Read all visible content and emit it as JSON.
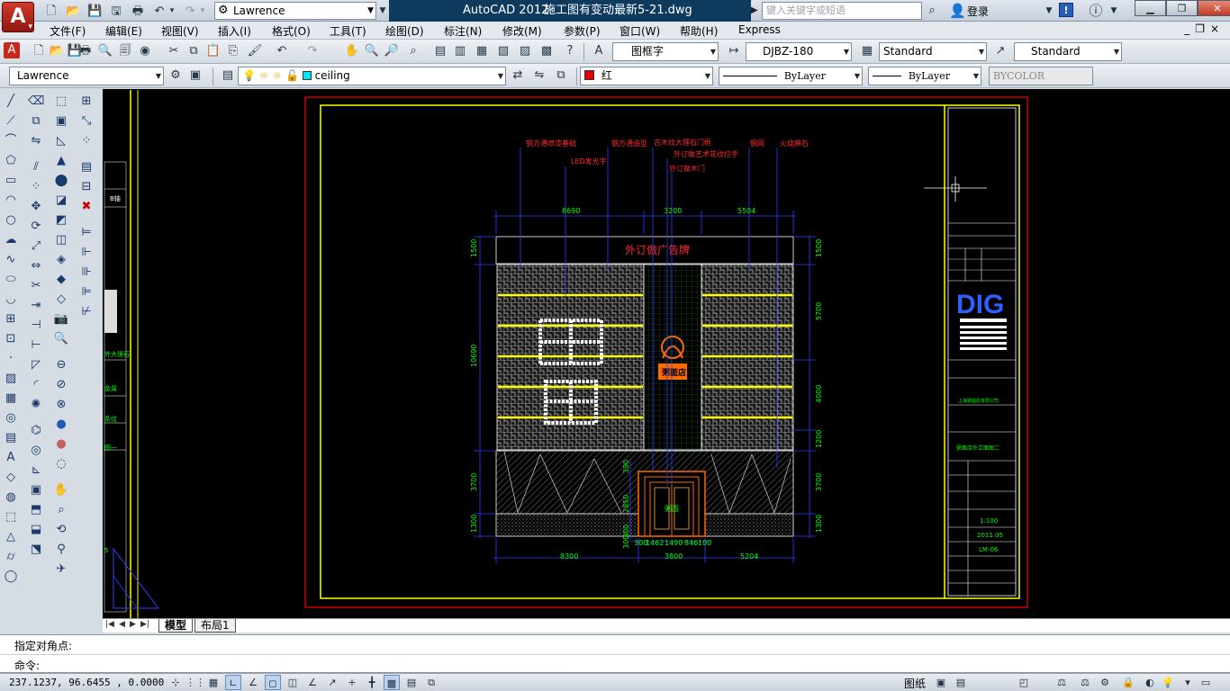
{
  "app": {
    "logo_letter": "A",
    "workspace": "Lawrence",
    "product": "AutoCAD 2012",
    "filename": "施工图有变动最新5-21.dwg",
    "search_placeholder": "键入关键字或短语",
    "login": "登录"
  },
  "menu": [
    "文件(F)",
    "编辑(E)",
    "视图(V)",
    "插入(I)",
    "格式(O)",
    "工具(T)",
    "绘图(D)",
    "标注(N)",
    "修改(M)",
    "参数(P)",
    "窗口(W)",
    "帮助(H)",
    "Express"
  ],
  "toolbar1": {
    "text_style": "图框字",
    "dim_style": "DJBZ-180",
    "table_style": "Standard",
    "multileader_style": "Standard"
  },
  "toolbar2": {
    "workspace": "Lawrence",
    "layer": "ceiling",
    "color": "红",
    "linetype": "ByLayer",
    "lineweight": "ByLayer",
    "plotstyle": "BYCOLOR"
  },
  "drawing": {
    "title": "外订做广告牌",
    "labels": [
      "钢方通喷漆基础",
      "LED发光字",
      "钢方通造型",
      "古木纹大理石门框",
      "外订做艺术花纹拉手",
      "外订做木门",
      "钢网",
      "火烧麻石"
    ],
    "dims_top": [
      "8690",
      "3200",
      "5504"
    ],
    "dims_bottom": [
      "8300",
      "3800",
      "5204"
    ],
    "dims_bottom_detail": [
      "300",
      "1462",
      "1490",
      "846",
      "100"
    ],
    "dims_left": [
      "1500",
      "10690",
      "3700",
      "1300"
    ],
    "dims_right": [
      "1500",
      "5700",
      "4000",
      "1200",
      "3700",
      "1300"
    ],
    "dims_center": [
      "390",
      "2850",
      "300",
      "300"
    ],
    "brand_text": "DIG",
    "sign_text": "粥面店",
    "door_text": "粥面",
    "titleblock": {
      "scale": "1:100",
      "date": "2011.05",
      "sheet": "LM-06",
      "project": "粥面店外立面图二",
      "owner": "上海粥面店有限公司"
    },
    "left_strip": [
      "B轴",
      "外大理石",
      "金属",
      "条纹",
      "图一",
      "5"
    ]
  },
  "tabs": [
    "模型",
    "布局1"
  ],
  "command": {
    "history": "指定对角点:",
    "prompt": "命令:"
  },
  "status": {
    "coords": "237.1237, 96.6455 , 0.0000",
    "paper": "图纸"
  },
  "colors": {
    "accent_red": "#c0392b",
    "title_bg": "#0e3a5e",
    "drawing_bg": "#000000",
    "cad_yellow": "#ffff00",
    "cad_red": "#ff0000",
    "cad_blue": "#2f3fff",
    "cad_green": "#00ff00"
  }
}
